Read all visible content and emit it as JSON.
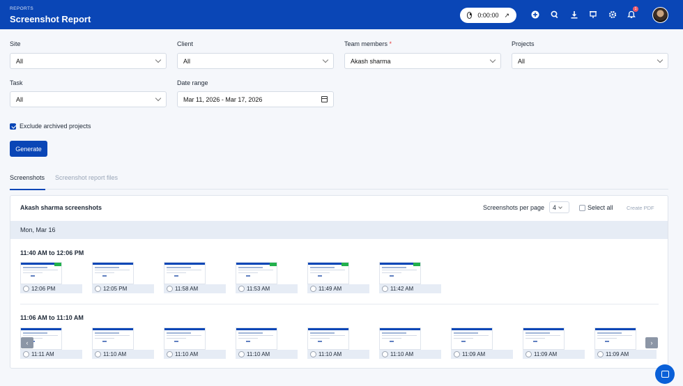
{
  "header": {
    "eyebrow": "REPORTS",
    "title": "Screenshot Report",
    "timer": "0:00:00",
    "timer_arrow": "↗",
    "notification_count": "1",
    "icons": [
      "plus-circle-icon",
      "search-icon",
      "download-icon",
      "presentation-icon",
      "gear-icon",
      "bell-icon"
    ]
  },
  "filters": {
    "site": {
      "label": "Site",
      "value": "All"
    },
    "client": {
      "label": "Client",
      "value": "All"
    },
    "team_members": {
      "label": "Team members",
      "required": "*",
      "value": "Akash sharma"
    },
    "projects": {
      "label": "Projects",
      "value": "All"
    },
    "task": {
      "label": "Task",
      "value": "All"
    },
    "date_range": {
      "label": "Date range",
      "value": "Mar 11, 2026 - Mar 17, 2026"
    }
  },
  "exclude_archived": "Exclude archived projects",
  "generate_label": "Generate",
  "tabs": [
    "Screenshots",
    "Screenshot report files"
  ],
  "panel": {
    "title": "Akash sharma screenshots",
    "per_page_label": "Screenshots per page",
    "per_page_value": "4",
    "select_all": "Select all",
    "create_pdf": "Create PDF",
    "day": "Mon, Mar 16",
    "groups": [
      {
        "range": "11:40 AM to 12:06 PM",
        "shots": [
          "12:06 PM",
          "12:05 PM",
          "11:58 AM",
          "11:53 AM",
          "11:49 AM",
          "11:42 AM"
        ]
      },
      {
        "range": "11:06 AM to 11:10 AM",
        "shots": [
          "11:11 AM",
          "11:10 AM",
          "11:10 AM",
          "11:10 AM",
          "11:10 AM",
          "11:10 AM",
          "11:09 AM",
          "11:09 AM",
          "11:09 AM"
        ]
      }
    ],
    "prev": "‹",
    "next": "›"
  },
  "colors": {
    "primary": "#0a46b6",
    "band": "#e6ecf5",
    "badge": "#ef5b6b"
  }
}
